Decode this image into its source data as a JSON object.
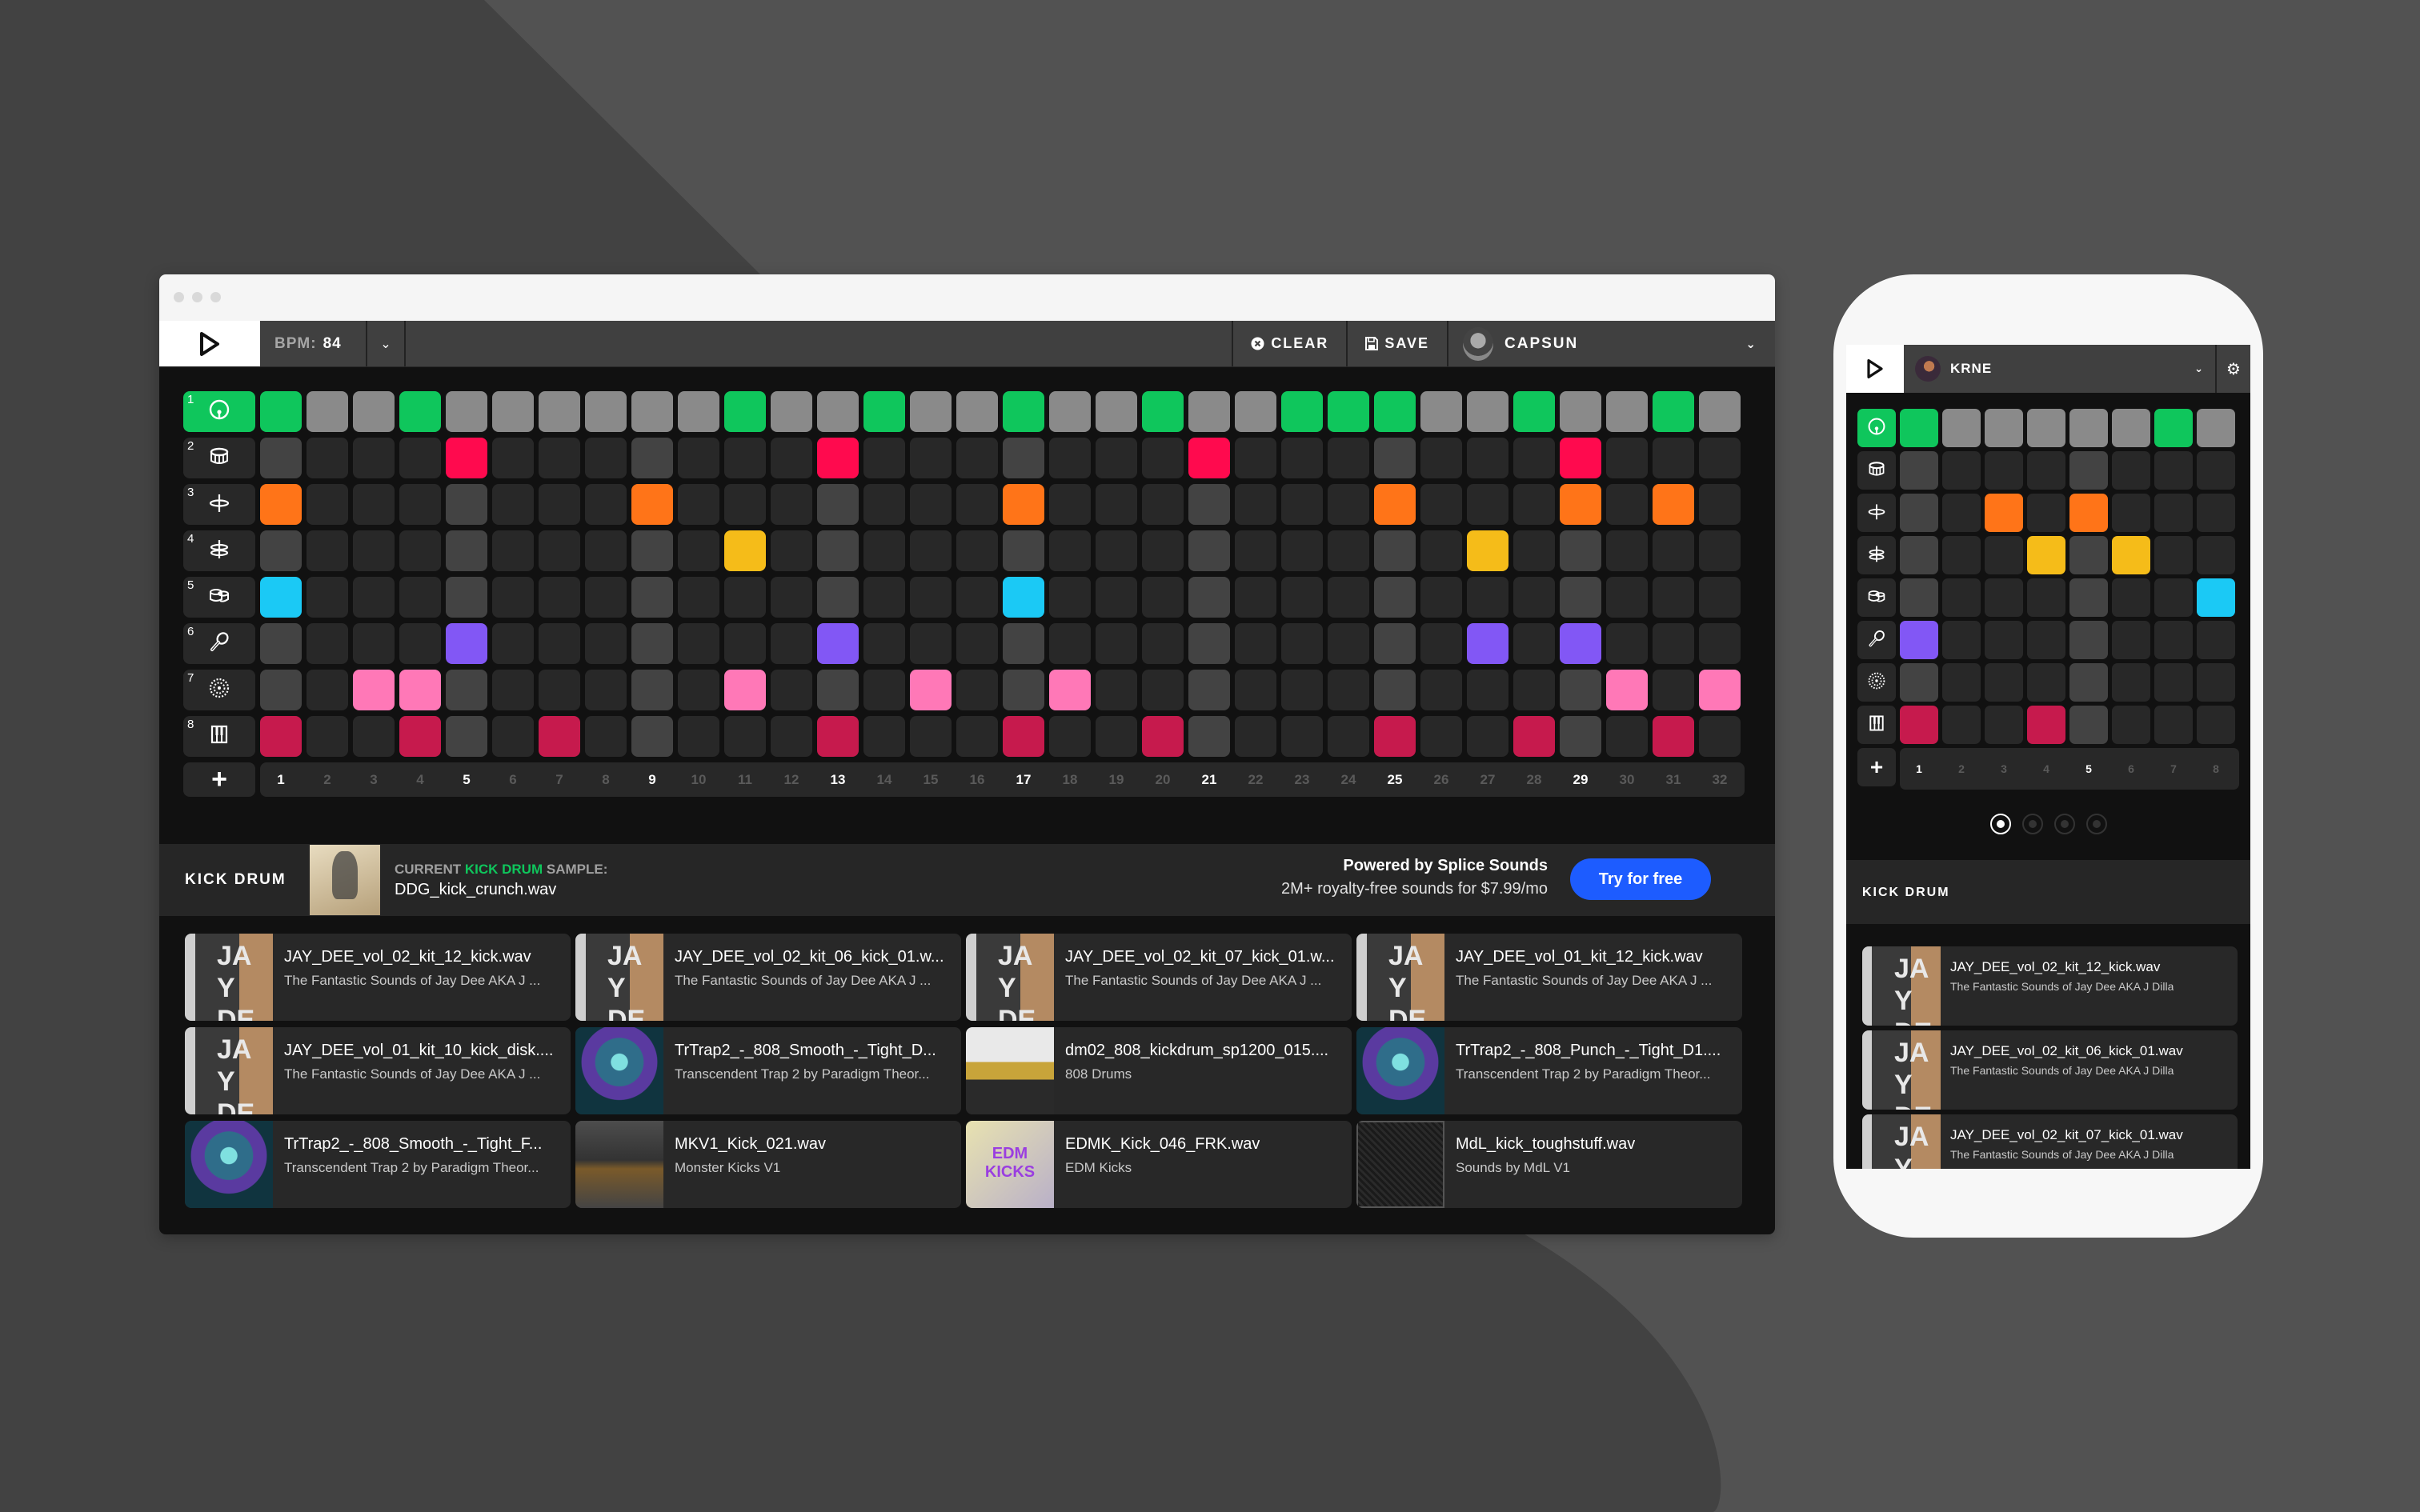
{
  "colors": {
    "bg_light": "#525252",
    "bg_dark": "#424242",
    "accent_green": "#0fc65c",
    "cta_blue": "#1d5cff"
  },
  "desktop": {
    "toolbar": {
      "play_icon": "play-icon",
      "bpm_label": "BPM:",
      "bpm_value": "84",
      "bpm_dropdown_icon": "chevron-down-icon",
      "clear_label": "CLEAR",
      "clear_icon": "close-circle-icon",
      "save_label": "SAVE",
      "save_icon": "floppy-disk-icon",
      "user_name": "CAPSUN",
      "user_dropdown_icon": "chevron-down-icon"
    },
    "tracks": [
      {
        "num": "1",
        "icon": "kick-drum-icon",
        "color": "#0fc65c",
        "active": [
          1,
          4,
          11,
          14,
          17,
          20,
          23,
          24,
          25,
          28,
          31
        ]
      },
      {
        "num": "2",
        "icon": "snare-drum-icon",
        "color": "#ff0a4e",
        "active": [
          5,
          13,
          21,
          29
        ]
      },
      {
        "num": "3",
        "icon": "hihat-closed-icon",
        "color": "#ff7418",
        "active": [
          1,
          9,
          17,
          25,
          29,
          31
        ]
      },
      {
        "num": "4",
        "icon": "hihat-open-icon",
        "color": "#f5bc19",
        "active": [
          11,
          27
        ]
      },
      {
        "num": "5",
        "icon": "toms-icon",
        "color": "#1bc9f5",
        "active": [
          1,
          17
        ]
      },
      {
        "num": "6",
        "icon": "maraca-icon",
        "color": "#8257f5",
        "active": [
          5,
          13,
          27,
          29
        ]
      },
      {
        "num": "7",
        "icon": "tambourine-icon",
        "color": "#ff78b7",
        "active": [
          3,
          4,
          11,
          15,
          18,
          30,
          32
        ]
      },
      {
        "num": "8",
        "icon": "keys-icon",
        "color": "#c61a4d",
        "active": [
          1,
          4,
          7,
          13,
          17,
          20,
          25,
          28,
          31
        ]
      }
    ],
    "selected_track": 1,
    "step_count": 32,
    "beat_steps": [
      1,
      5,
      9,
      13,
      17,
      21,
      25,
      29
    ],
    "steps": [
      "1",
      "2",
      "3",
      "4",
      "5",
      "6",
      "7",
      "8",
      "9",
      "10",
      "11",
      "12",
      "13",
      "14",
      "15",
      "16",
      "17",
      "18",
      "19",
      "20",
      "21",
      "22",
      "23",
      "24",
      "25",
      "26",
      "27",
      "28",
      "29",
      "30",
      "31",
      "32"
    ],
    "add_track_label": "+",
    "sample_bar": {
      "title": "KICK DRUM",
      "current_prefix": "CURRENT",
      "current_highlight": "KICK DRUM",
      "current_suffix": "SAMPLE:",
      "current_sample": "DDG_kick_crunch.wav",
      "splice_title": "Powered by Splice Sounds",
      "splice_sub": "2M+ royalty-free sounds for $7.99/mo",
      "try_label": "Try for free"
    },
    "samples": [
      {
        "name": "JAY_DEE_vol_02_kit_12_kick.wav",
        "pack": "The Fantastic Sounds of Jay Dee AKA J ...",
        "thumb": "jay"
      },
      {
        "name": "JAY_DEE_vol_02_kit_06_kick_01.w...",
        "pack": "The Fantastic Sounds of Jay Dee AKA J ...",
        "thumb": "jay"
      },
      {
        "name": "JAY_DEE_vol_02_kit_07_kick_01.w...",
        "pack": "The Fantastic Sounds of Jay Dee AKA J ...",
        "thumb": "jay"
      },
      {
        "name": "JAY_DEE_vol_01_kit_12_kick.wav",
        "pack": "The Fantastic Sounds of Jay Dee AKA J ...",
        "thumb": "jay"
      },
      {
        "name": "JAY_DEE_vol_01_kit_10_kick_disk....",
        "pack": "The Fantastic Sounds of Jay Dee AKA J ...",
        "thumb": "jay"
      },
      {
        "name": "TrTrap2_-_808_Smooth_-_Tight_D...",
        "pack": "Transcendent Trap 2 by Paradigm Theor...",
        "thumb": "trap"
      },
      {
        "name": "dm02_808_kickdrum_sp1200_015....",
        "pack": "808 Drums",
        "thumb": "808"
      },
      {
        "name": "TrTrap2_-_808_Punch_-_Tight_D1....",
        "pack": "Transcendent Trap 2 by Paradigm Theor...",
        "thumb": "trap"
      },
      {
        "name": "TrTrap2_-_808_Smooth_-_Tight_F...",
        "pack": "Transcendent Trap 2 by Paradigm Theor...",
        "thumb": "trap"
      },
      {
        "name": "MKV1_Kick_021.wav",
        "pack": "Monster Kicks V1",
        "thumb": "monster"
      },
      {
        "name": "EDMK_Kick_046_FRK.wav",
        "pack": "EDM Kicks",
        "thumb": "edm"
      },
      {
        "name": "MdL_kick_toughstuff.wav",
        "pack": "Sounds by MdL V1",
        "thumb": "mdl"
      }
    ]
  },
  "mobile": {
    "toolbar": {
      "play_icon": "play-icon",
      "user_name": "KRNE",
      "dropdown_icon": "chevron-down-icon",
      "settings_icon": "gear-icon"
    },
    "tracks": [
      {
        "icon": "kick-drum-icon",
        "color": "#0fc65c",
        "active": [
          1,
          7
        ]
      },
      {
        "icon": "snare-drum-icon",
        "color": "#ff0a4e",
        "active": []
      },
      {
        "icon": "hihat-closed-icon",
        "color": "#ff7418",
        "active": [
          3,
          5
        ]
      },
      {
        "icon": "hihat-open-icon",
        "color": "#f5bc19",
        "active": [
          4,
          6
        ]
      },
      {
        "icon": "toms-icon",
        "color": "#1bc9f5",
        "active": [
          8
        ]
      },
      {
        "icon": "maraca-icon",
        "color": "#8257f5",
        "active": [
          1
        ]
      },
      {
        "icon": "tambourine-icon",
        "color": "#ff78b7",
        "active": []
      },
      {
        "icon": "keys-icon",
        "color": "#c61a4d",
        "active": [
          1,
          4
        ]
      }
    ],
    "beat_steps": [
      1,
      5
    ],
    "steps": [
      "1",
      "2",
      "3",
      "4",
      "5",
      "6",
      "7",
      "8"
    ],
    "add_track_label": "+",
    "pages": 4,
    "current_page": 1,
    "section_title": "KICK DRUM",
    "samples": [
      {
        "name": "JAY_DEE_vol_02_kit_12_kick.wav",
        "pack": "The Fantastic Sounds of Jay Dee AKA J Dilla",
        "thumb": "jay"
      },
      {
        "name": "JAY_DEE_vol_02_kit_06_kick_01.wav",
        "pack": "The Fantastic Sounds of Jay Dee AKA J Dilla",
        "thumb": "jay"
      },
      {
        "name": "JAY_DEE_vol_02_kit_07_kick_01.wav",
        "pack": "The Fantastic Sounds of Jay Dee AKA J Dilla",
        "thumb": "jay"
      }
    ]
  }
}
